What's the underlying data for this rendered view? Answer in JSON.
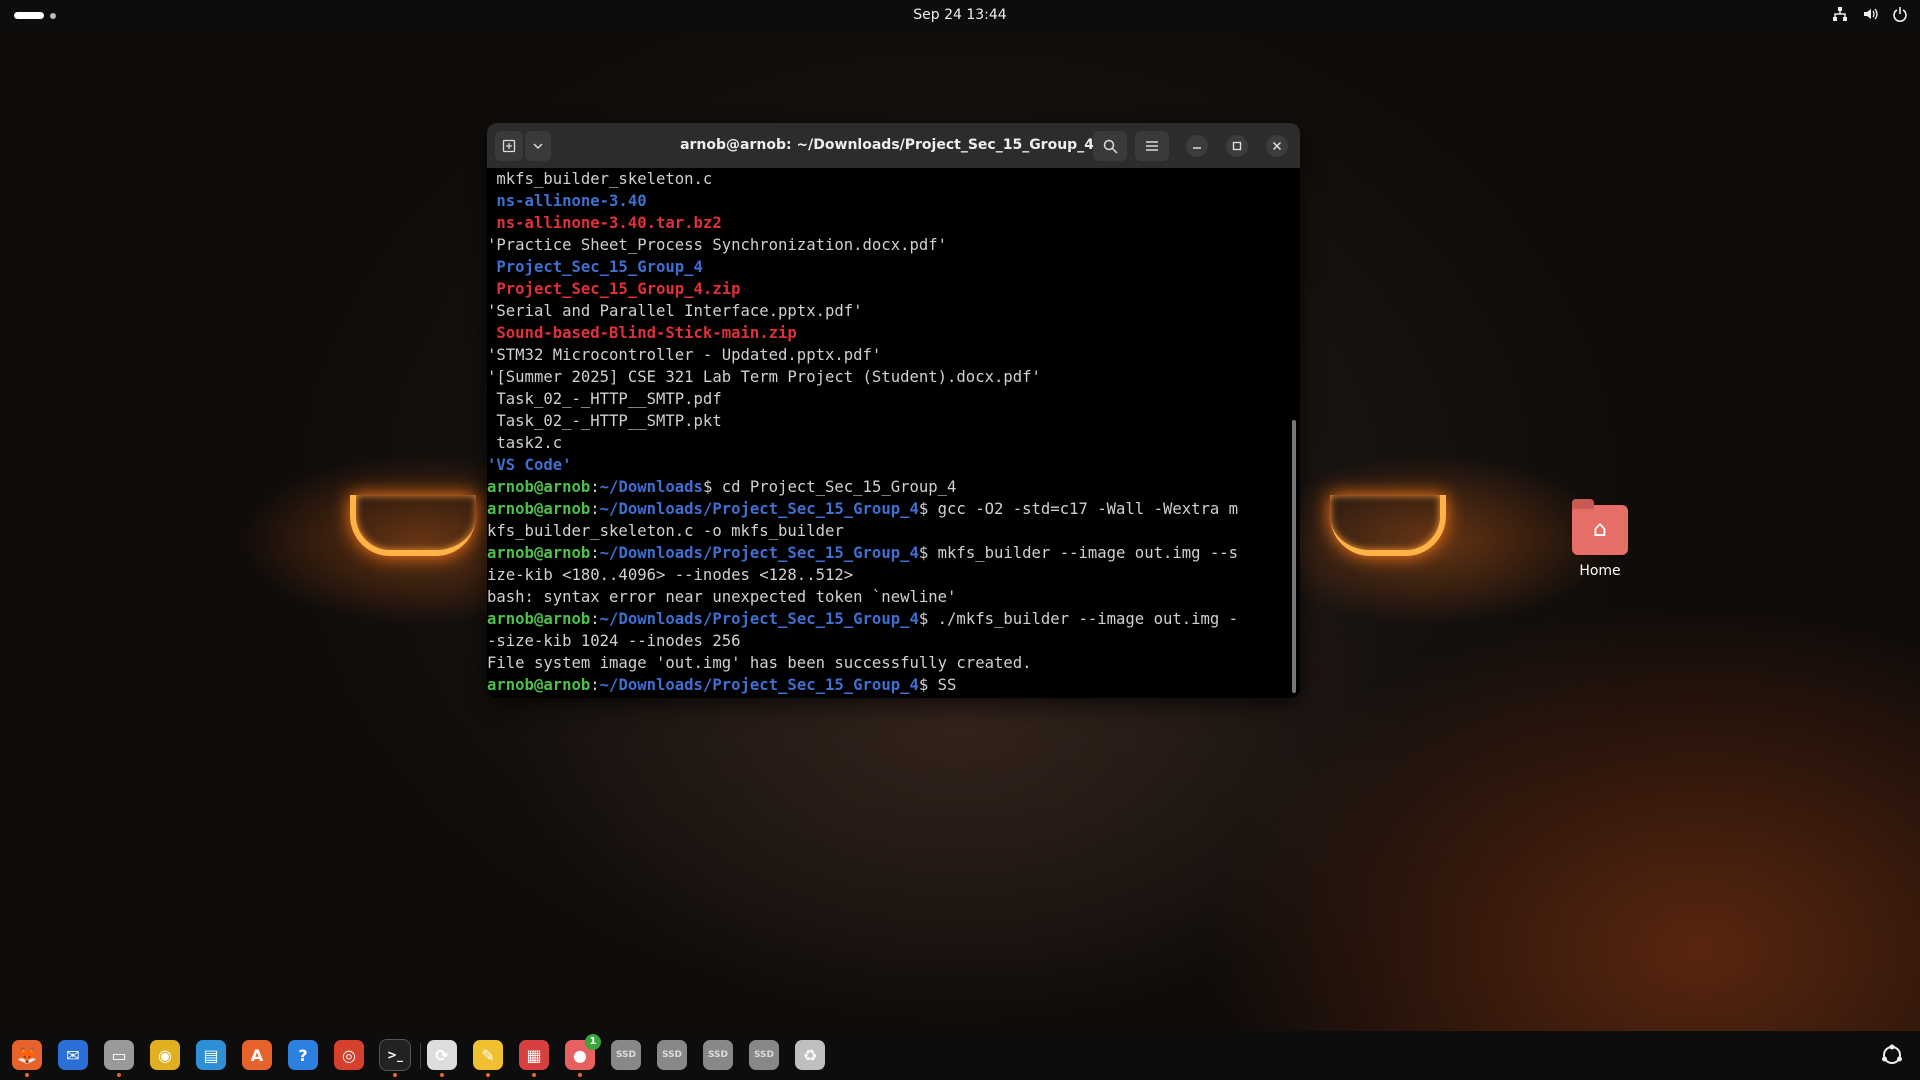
{
  "topbar": {
    "datetime": "Sep 24  13:44",
    "network_icon": "network-icon",
    "volume_icon": "volume-icon",
    "power_icon": "power-icon"
  },
  "terminal": {
    "title": "arnob@arnob: ~/Downloads/Project_Sec_15_Group_4",
    "lines": [
      {
        "parts": [
          {
            "t": " mkfs_builder_skeleton.c",
            "c": ""
          }
        ]
      },
      {
        "parts": [
          {
            "t": " ns-allinone-3.40",
            "c": "blue"
          }
        ]
      },
      {
        "parts": [
          {
            "t": " ns-allinone-3.40.tar.bz2",
            "c": "red"
          }
        ]
      },
      {
        "parts": [
          {
            "t": "'Practice Sheet_Process Synchronization.docx.pdf'",
            "c": ""
          }
        ]
      },
      {
        "parts": [
          {
            "t": " Project_Sec_15_Group_4",
            "c": "blue"
          }
        ]
      },
      {
        "parts": [
          {
            "t": " Project_Sec_15_Group_4.zip",
            "c": "red"
          }
        ]
      },
      {
        "parts": [
          {
            "t": "'Serial and Parallel Interface.pptx.pdf'",
            "c": ""
          }
        ]
      },
      {
        "parts": [
          {
            "t": " Sound-based-Blind-Stick-main.zip",
            "c": "red"
          }
        ]
      },
      {
        "parts": [
          {
            "t": "'STM32 Microcontroller - Updated.pptx.pdf'",
            "c": ""
          }
        ]
      },
      {
        "parts": [
          {
            "t": "'[Summer 2025] CSE 321 Lab Term Project (Student).docx.pdf'",
            "c": ""
          }
        ]
      },
      {
        "parts": [
          {
            "t": " Task_02_-_HTTP__SMTP.pdf",
            "c": ""
          }
        ]
      },
      {
        "parts": [
          {
            "t": " Task_02_-_HTTP__SMTP.pkt",
            "c": ""
          }
        ]
      },
      {
        "parts": [
          {
            "t": " task2.c",
            "c": ""
          }
        ]
      },
      {
        "parts": [
          {
            "t": "'VS Code'",
            "c": "blue"
          }
        ]
      },
      {
        "parts": [
          {
            "t": "arnob@arnob",
            "c": "pg"
          },
          {
            "t": ":",
            "c": ""
          },
          {
            "t": "~/Downloads",
            "c": "pb"
          },
          {
            "t": "$ cd Project_Sec_15_Group_4",
            "c": ""
          }
        ]
      },
      {
        "parts": [
          {
            "t": "arnob@arnob",
            "c": "pg"
          },
          {
            "t": ":",
            "c": ""
          },
          {
            "t": "~/Downloads/Project_Sec_15_Group_4",
            "c": "pb"
          },
          {
            "t": "$ gcc -O2 -std=c17 -Wall -Wextra m",
            "c": ""
          }
        ]
      },
      {
        "parts": [
          {
            "t": "kfs_builder_skeleton.c -o mkfs_builder",
            "c": ""
          }
        ]
      },
      {
        "parts": [
          {
            "t": "arnob@arnob",
            "c": "pg"
          },
          {
            "t": ":",
            "c": ""
          },
          {
            "t": "~/Downloads/Project_Sec_15_Group_4",
            "c": "pb"
          },
          {
            "t": "$ mkfs_builder --image out.img --s",
            "c": ""
          }
        ]
      },
      {
        "parts": [
          {
            "t": "ize-kib <180..4096> --inodes <128..512>",
            "c": ""
          }
        ]
      },
      {
        "parts": [
          {
            "t": "bash: syntax error near unexpected token `newline'",
            "c": ""
          }
        ]
      },
      {
        "parts": [
          {
            "t": "arnob@arnob",
            "c": "pg"
          },
          {
            "t": ":",
            "c": ""
          },
          {
            "t": "~/Downloads/Project_Sec_15_Group_4",
            "c": "pb"
          },
          {
            "t": "$ ./mkfs_builder --image out.img -",
            "c": ""
          }
        ]
      },
      {
        "parts": [
          {
            "t": "-size-kib 1024 --inodes 256",
            "c": ""
          }
        ]
      },
      {
        "parts": [
          {
            "t": "File system image 'out.img' has been successfully created.",
            "c": ""
          }
        ]
      },
      {
        "parts": [
          {
            "t": "arnob@arnob",
            "c": "pg"
          },
          {
            "t": ":",
            "c": ""
          },
          {
            "t": "~/Downloads/Project_Sec_15_Group_4",
            "c": "pb"
          },
          {
            "t": "$ SS",
            "c": ""
          }
        ]
      }
    ]
  },
  "desktop": {
    "home_label": "Home"
  },
  "dock": {
    "items": [
      {
        "name": "firefox-icon",
        "color": "#e8622c",
        "glyph": "🦊"
      },
      {
        "name": "thunderbird-icon",
        "color": "#2a6fd6",
        "glyph": "✉"
      },
      {
        "name": "files-icon",
        "color": "#9a9a9a",
        "glyph": "▭"
      },
      {
        "name": "rhythmbox-icon",
        "color": "#e0b020",
        "glyph": "◉"
      },
      {
        "name": "writer-icon",
        "color": "#2d8fd5",
        "glyph": "▤"
      },
      {
        "name": "app-center-icon",
        "color": "#e8622c",
        "glyph": "A"
      },
      {
        "name": "help-icon",
        "color": "#2d7fe0",
        "glyph": "?"
      },
      {
        "name": "chrome-icon",
        "color": "#d8402e",
        "glyph": "◎"
      },
      {
        "name": "terminal-icon",
        "color": "#333333",
        "glyph": ">_"
      },
      {
        "name": "software-updater-icon",
        "color": "#dddddd",
        "glyph": "⟳"
      },
      {
        "name": "text-editor-icon",
        "color": "#f0c030",
        "glyph": "✎"
      },
      {
        "name": "pdf-viewer-icon",
        "color": "#d84040",
        "glyph": "▦"
      },
      {
        "name": "app-badge-icon",
        "color": "#e86060",
        "glyph": "●"
      },
      {
        "name": "ssd-drive-1-icon",
        "color": "#888888",
        "glyph": "SSD"
      },
      {
        "name": "ssd-drive-2-icon",
        "color": "#888888",
        "glyph": "SSD"
      },
      {
        "name": "ssd-drive-3-icon",
        "color": "#888888",
        "glyph": "SSD"
      },
      {
        "name": "ssd-drive-4-icon",
        "color": "#888888",
        "glyph": "SSD"
      },
      {
        "name": "trash-icon",
        "color": "#bfbfbf",
        "glyph": "♻"
      }
    ],
    "badge_count": "1"
  }
}
